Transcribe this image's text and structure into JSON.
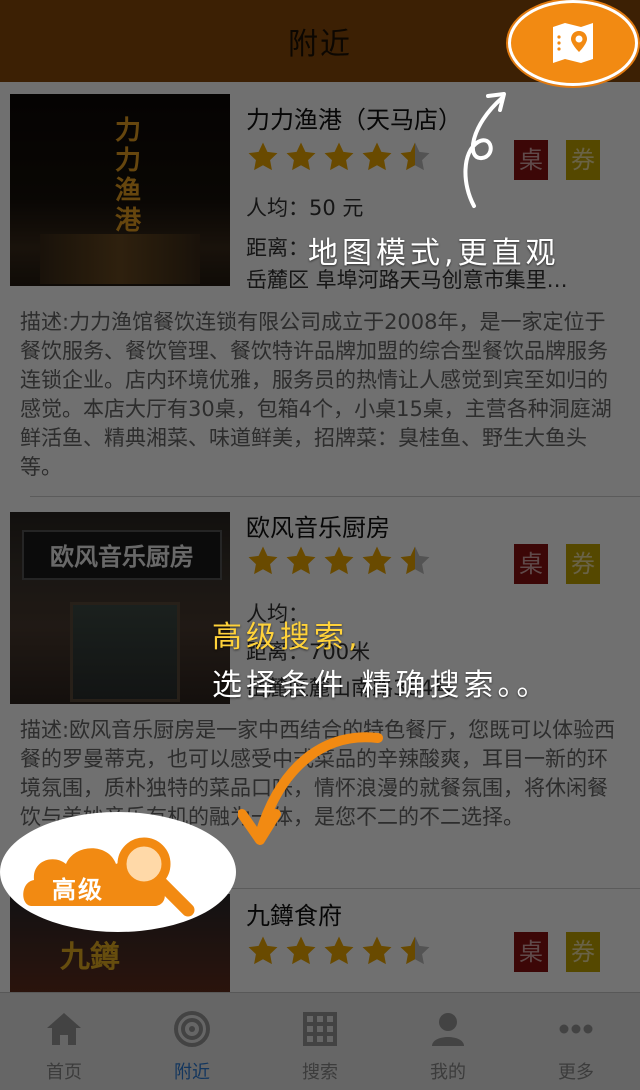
{
  "header": {
    "title": "附近"
  },
  "colors": {
    "header_bg": "#8a4a0b",
    "accent_orange": "#f28a12",
    "star_gold": "#f0a800",
    "desk_badge": "#8a1010",
    "coupon_badge": "#c2a400",
    "tab_active": "#2c7bd6"
  },
  "restaurants": [
    {
      "name": "力力渔港（天马店）",
      "rating": 4.5,
      "badges": [
        "桌",
        "券"
      ],
      "avg_price": "人均：50 元",
      "distance": "距离：",
      "address": "岳麓区 阜埠河路天马创意市集里…",
      "description": "描述:力力渔馆餐饮连锁有限公司成立于2008年，是一家定位于餐饮服务、餐饮管理、餐饮特许品牌加盟的综合型餐饮品牌服务连锁企业。店内环境优雅，服务员的热情让人感觉到宾至如归的感觉。本店大厅有30桌，包箱4个，小桌15桌，主营各种洞庭湖鲜活鱼、精典湘菜、味道鲜美，招牌菜：臭桂鱼、野生大鱼头等。",
      "photo_sign": "力力渔港"
    },
    {
      "name": "欧风音乐厨房",
      "rating": 4.5,
      "badges": [
        "桌",
        "券"
      ],
      "avg_price": "人均：",
      "distance": "距离：700米",
      "address": "岳麓区麓山南路384号",
      "description": "描述:欧风音乐厨房是一家中西结合的特色餐厅，您既可以体验西餐的罗曼蒂克，也可以感受中式菜品的辛辣酸爽，耳目一新的环境氛围，质朴独特的菜品口味，情怀浪漫的就餐氛围，将休闲餐饮与美妙音乐有机的融为一体，是您不二的不二选择。",
      "photo_sign": "欧风音乐厨房"
    },
    {
      "name": "九鐏食府",
      "rating": 4.5,
      "badges": [
        "桌",
        "券"
      ],
      "photo_sign": "九鐏"
    }
  ],
  "tips": {
    "map_mode": "地图模式,更直观",
    "advanced_search_1": "高级搜索,",
    "advanced_search_2": "选择条件 精确搜索。。",
    "advanced_button": "高级"
  },
  "tabbar": [
    {
      "label": "首页",
      "icon": "home-icon",
      "active": false
    },
    {
      "label": "附近",
      "icon": "target-icon",
      "active": true
    },
    {
      "label": "搜索",
      "icon": "grid-icon",
      "active": false
    },
    {
      "label": "我的",
      "icon": "user-icon",
      "active": false
    },
    {
      "label": "更多",
      "icon": "more-icon",
      "active": false
    }
  ]
}
